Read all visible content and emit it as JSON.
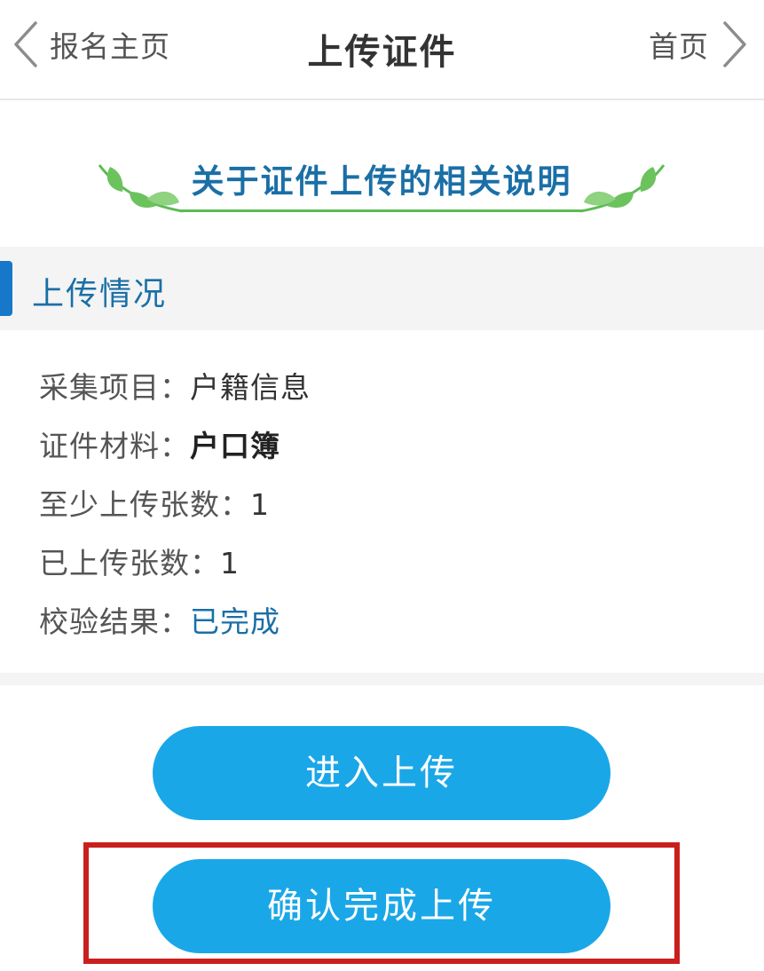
{
  "header": {
    "back_label": "报名主页",
    "title": "上传证件",
    "home_label": "首页"
  },
  "banner": {
    "text": "关于证件上传的相关说明"
  },
  "section": {
    "title": "上传情况"
  },
  "info": [
    {
      "label": "采集项目：",
      "value": "户籍信息"
    },
    {
      "label": "证件材料：",
      "value": "户口簿"
    },
    {
      "label": "至少上传张数：",
      "value": "1"
    },
    {
      "label": "已上传张数：",
      "value": "1"
    },
    {
      "label": "校验结果：",
      "value": "已完成"
    }
  ],
  "buttons": {
    "enter_upload": "进入上传",
    "confirm_upload": "确认完成上传"
  },
  "colors": {
    "accent_blue": "#1777c9",
    "button_blue": "#1aa7e8",
    "title_blue": "#1a6fa6",
    "leaf_green": "#5dbb55",
    "highlight_red": "#c9201e"
  },
  "icons": {
    "back": "chevron-left-icon",
    "home": "chevron-right-icon",
    "leaf": "leaf-icon"
  }
}
